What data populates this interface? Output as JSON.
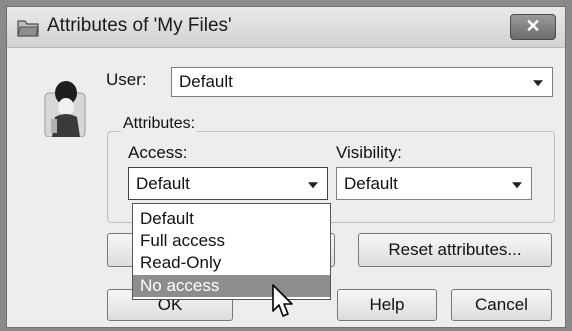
{
  "window": {
    "title": "Attributes of 'My Files'",
    "close_label": "✕"
  },
  "user": {
    "label": "User:",
    "selected": "Default"
  },
  "attributes_group": {
    "label": "Attributes:",
    "access": {
      "label": "Access:",
      "selected": "Default",
      "options": [
        "Default",
        "Full access",
        "Read-Only",
        "No access"
      ],
      "highlighted": "No access"
    },
    "visibility": {
      "label": "Visibility:",
      "selected": "Default"
    }
  },
  "buttons": {
    "reset": "Reset attributes...",
    "ok": "OK",
    "help": "Help",
    "cancel": "Cancel"
  },
  "icons": {
    "title": "folder-icon",
    "avatar": "user-avatar-icon",
    "cursor": "mouse-pointer-icon"
  }
}
